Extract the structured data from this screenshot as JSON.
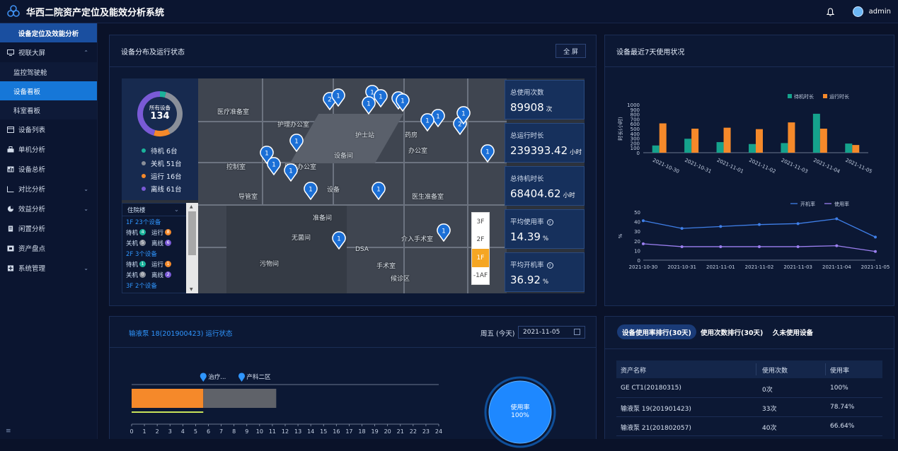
{
  "app": {
    "title": "华西二院资产定位及能效分析系统",
    "user": "admin"
  },
  "sidebar": {
    "header": "设备定位及效能分析",
    "items": [
      {
        "label": "视联大屏",
        "icon": "monitor-icon",
        "expanded": true,
        "children": [
          {
            "label": "监控驾驶舱"
          },
          {
            "label": "设备看板",
            "active": true
          },
          {
            "label": "科室看板"
          }
        ]
      },
      {
        "label": "设备列表",
        "icon": "list-icon"
      },
      {
        "label": "单机分析",
        "icon": "machine-icon"
      },
      {
        "label": "设备总析",
        "icon": "bar-icon"
      },
      {
        "label": "对比分析",
        "icon": "compare-icon",
        "has_children": true
      },
      {
        "label": "效益分析",
        "icon": "pie-icon",
        "has_children": true
      },
      {
        "label": "闲置分析",
        "icon": "document-icon"
      },
      {
        "label": "资产盘点",
        "icon": "scan-icon"
      },
      {
        "label": "系统管理",
        "icon": "settings-icon",
        "has_children": true
      }
    ],
    "footer_icon": "menu-collapse-icon"
  },
  "distribution": {
    "title": "设备分布及运行状态",
    "fullscreen_label": "全 屏",
    "donut": {
      "label": "所有设备",
      "total": "134",
      "segments": [
        {
          "name": "待机",
          "value": 6,
          "color": "#1bb39b"
        },
        {
          "name": "关机",
          "value": 51,
          "color": "#8a8f99"
        },
        {
          "name": "运行",
          "value": 16,
          "color": "#f5892a"
        },
        {
          "name": "离线",
          "value": 61,
          "color": "#7a5ad6"
        }
      ],
      "legend": [
        "待机 6台",
        "关机 51台",
        "运行 16台",
        "离线 61台"
      ]
    },
    "ward": {
      "selected": "住院楼",
      "lines": [
        {
          "text": "1F 23个设备",
          "blue": true
        },
        {
          "a": "待机",
          "an": "4",
          "ac": "#1bb39b",
          "b": "运行",
          "bn": "8",
          "bc": "#f5892a"
        },
        {
          "a": "关机",
          "an": "5",
          "ac": "#8a8f99",
          "b": "离线",
          "bn": "6",
          "bc": "#7a5ad6"
        },
        {
          "text": "2F 3个设备",
          "blue": true
        },
        {
          "a": "待机",
          "an": "1",
          "ac": "#1bb39b",
          "b": "运行",
          "bn": "1",
          "bc": "#f5892a"
        },
        {
          "a": "关机",
          "an": "0",
          "ac": "#8a8f99",
          "b": "离线",
          "bn": "2",
          "bc": "#7a5ad6"
        },
        {
          "text": "3F 2个设备",
          "blue": true
        }
      ]
    },
    "floors": [
      "3F",
      "2F",
      "1F",
      "-1AF"
    ],
    "active_floor": "1F",
    "map_labels": [
      "医疗准备室",
      "护理办公室",
      "设备间",
      "控制室",
      "医生办公室",
      "药房",
      "护士站",
      "DSA",
      "准备间",
      "手术室",
      "医生准备室",
      "介入手术室",
      "导管室",
      "设备",
      "候诊区",
      "办公室",
      "污物间",
      "无菌间"
    ],
    "kpis": [
      {
        "label": "总使用次数",
        "value": "89908",
        "unit": "次"
      },
      {
        "label": "总运行时长",
        "value": "239393.42",
        "unit": "小时"
      },
      {
        "label": "总待机时长",
        "value": "68404.62",
        "unit": "小时"
      },
      {
        "label": "平均使用率",
        "value": "14.39",
        "unit": "%",
        "help": true
      },
      {
        "label": "平均开机率",
        "value": "36.92",
        "unit": "%",
        "help": true
      }
    ]
  },
  "usage7": {
    "title": "设备最近7天使用状况",
    "chart_data": [
      {
        "type": "bar",
        "categories": [
          "2021-10-30",
          "2021-10-31",
          "2021-11-01",
          "2021-11-02",
          "2021-11-03",
          "2021-11-04",
          "2021-11-05"
        ],
        "series": [
          {
            "name": "待机时长",
            "values": [
              150,
              290,
              220,
              180,
              200,
              810,
              190
            ],
            "color": "#15a28c"
          },
          {
            "name": "运行时长",
            "values": [
              610,
              500,
              520,
              490,
              630,
              500,
              160
            ],
            "color": "#f5892a"
          }
        ],
        "ylabel": "时长(小时)",
        "ylim": [
          0,
          1000
        ],
        "yticks": [
          "0",
          "100",
          "200",
          "300",
          "400",
          "500",
          "600",
          "700",
          "800",
          "900",
          "1000"
        ],
        "legend": "top-right"
      },
      {
        "type": "line",
        "categories": [
          "2021-10-30",
          "2021-10-31",
          "2021-11-01",
          "2021-11-02",
          "2021-11-03",
          "2021-11-04",
          "2021-11-05"
        ],
        "series": [
          {
            "name": "开机率",
            "values": [
              41,
              33,
              35,
              37,
              38,
              43,
              24
            ],
            "color": "#3f7fe8"
          },
          {
            "name": "使用率",
            "values": [
              17,
              14,
              14,
              14,
              14,
              15,
              9
            ],
            "color": "#9b7ff0"
          }
        ],
        "ylabel": "%",
        "ylim": [
          0,
          50
        ],
        "yticks": [
          "0",
          "10",
          "20",
          "30",
          "40",
          "50"
        ],
        "legend": "top-right"
      }
    ]
  },
  "device_status": {
    "title": "输液泵 18(201900423) 运行状态",
    "day": "周五 (今天)",
    "date": "2021-11-05",
    "locations": [
      "治疗...",
      "产科二区"
    ],
    "timeline": {
      "segments": [
        {
          "from": 0,
          "to": 5.6,
          "color": "#f5892a"
        },
        {
          "from": 5.6,
          "to": 11.3,
          "color": "#5f6269"
        }
      ],
      "ticks": [
        "0",
        "1",
        "2",
        "3",
        "4",
        "5",
        "6",
        "7",
        "8",
        "9",
        "10",
        "11",
        "12",
        "13",
        "14",
        "15",
        "16",
        "17",
        "18",
        "19",
        "20",
        "21",
        "22",
        "23",
        "24"
      ]
    },
    "gauge": {
      "label": "使用率",
      "value": "100%"
    }
  },
  "ranking": {
    "tabs": [
      "设备使用率排行(30天)",
      "使用次数排行(30天)",
      "久未使用设备"
    ],
    "active_tab": 0,
    "headers": [
      "资产名称",
      "使用次数",
      "使用率"
    ],
    "rows": [
      [
        "GE CT1(20180315)",
        "0次",
        "100%"
      ],
      [
        "输液泵 19(201901423)",
        "33次",
        "78.74%"
      ],
      [
        "输液泵 21(201802057)",
        "40次",
        "66.64%"
      ]
    ]
  }
}
